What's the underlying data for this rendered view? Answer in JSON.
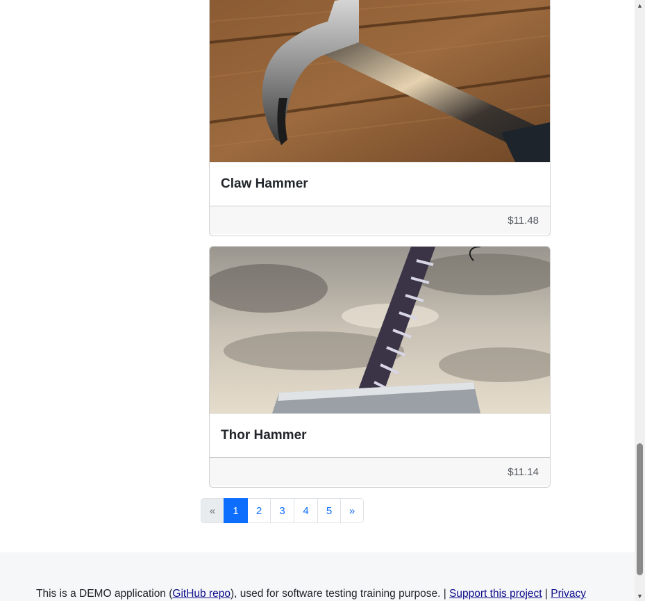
{
  "products": [
    {
      "name": "Claw Hammer",
      "price": "$11.48",
      "image_icon": "claw-hammer-photo"
    },
    {
      "name": "Thor Hammer",
      "price": "$11.14",
      "image_icon": "thor-hammer-photo"
    }
  ],
  "pagination": {
    "prev": "«",
    "pages": [
      "1",
      "2",
      "3",
      "4",
      "5"
    ],
    "active_page": "1",
    "next": "»"
  },
  "footer": {
    "text_1": "This is a DEMO application (",
    "github_link": "GitHub repo",
    "text_2": "), used for software testing training purpose. | ",
    "support_link": "Support this project",
    "text_3": " | ",
    "privacy_link": "Privacy"
  },
  "colors": {
    "accent": "#0d6efd",
    "footer_bg": "#f6f7f8",
    "card_footer_bg": "#f7f7f7"
  }
}
